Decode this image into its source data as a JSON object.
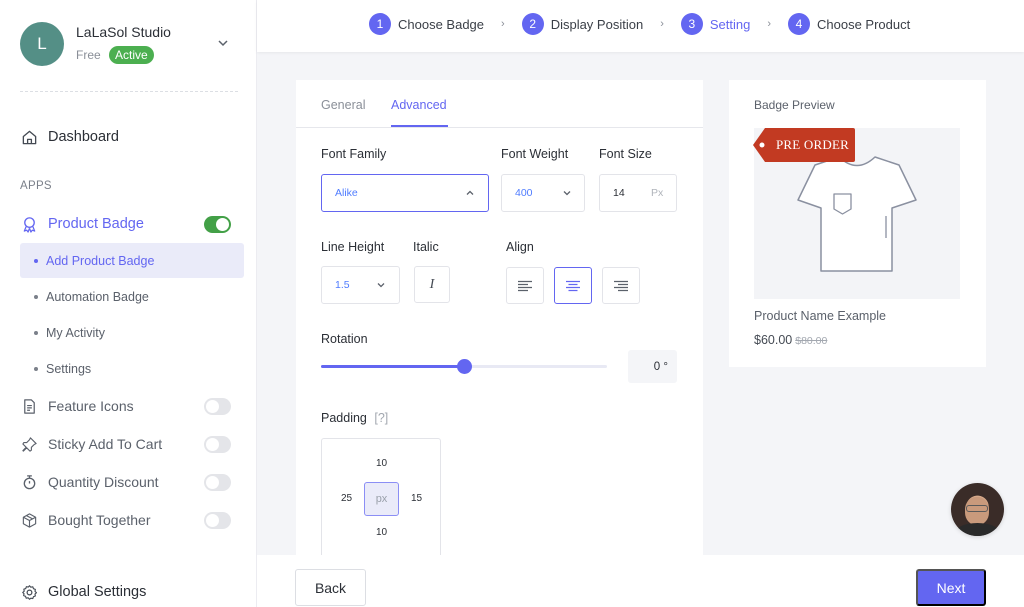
{
  "account": {
    "initial": "L",
    "name": "LaLaSol Studio",
    "plan": "Free",
    "status": "Active",
    "avatar_color": "#548f86",
    "status_color": "#4caf50"
  },
  "sidebar": {
    "dashboard": "Dashboard",
    "apps_heading": "APPS",
    "product_badge": {
      "label": "Product Badge",
      "enabled": true
    },
    "sub_items": [
      {
        "label": "Add Product Badge",
        "active": true
      },
      {
        "label": "Automation Badge",
        "active": false
      },
      {
        "label": "My Activity",
        "active": false
      },
      {
        "label": "Settings",
        "active": false
      }
    ],
    "apps": [
      {
        "label": "Feature Icons",
        "icon": "document-icon",
        "enabled": false
      },
      {
        "label": "Sticky Add To Cart",
        "icon": "pin-icon",
        "enabled": false
      },
      {
        "label": "Quantity Discount",
        "icon": "timer-icon",
        "enabled": false
      },
      {
        "label": "Bought Together",
        "icon": "box-icon",
        "enabled": false
      }
    ],
    "global_settings": "Global Settings"
  },
  "stepper": {
    "steps": [
      {
        "num": "1",
        "label": "Choose Badge"
      },
      {
        "num": "2",
        "label": "Display Position"
      },
      {
        "num": "3",
        "label": "Setting",
        "current": true
      },
      {
        "num": "4",
        "label": "Choose Product"
      }
    ],
    "separator": "›"
  },
  "settings": {
    "tabs": [
      {
        "label": "General",
        "active": false
      },
      {
        "label": "Advanced",
        "active": true
      }
    ],
    "font_family": {
      "label": "Font Family",
      "value": "Alike"
    },
    "font_weight": {
      "label": "Font Weight",
      "value": "400"
    },
    "font_size": {
      "label": "Font Size",
      "value": "14",
      "unit": "Px"
    },
    "line_height": {
      "label": "Line Height",
      "value": "1.5"
    },
    "italic": {
      "label": "Italic",
      "glyph": "I"
    },
    "align": {
      "label": "Align",
      "options": [
        "left",
        "center",
        "right"
      ],
      "selected": "center"
    },
    "rotation": {
      "label": "Rotation",
      "value": "0 °",
      "slider_fraction": 0.5
    },
    "padding": {
      "label": "Padding",
      "help": "[?]",
      "top": "10",
      "right": "15",
      "bottom": "10",
      "left": "25",
      "unit": "px"
    }
  },
  "preview": {
    "title": "Badge Preview",
    "badge_text": "PRE ORDER",
    "badge_color": "#c23a22",
    "product_name": "Product Name Example",
    "price": "$60.00",
    "old_price": "$80.00"
  },
  "footer": {
    "back": "Back",
    "next": "Next"
  },
  "accent_color": "#6366f1"
}
